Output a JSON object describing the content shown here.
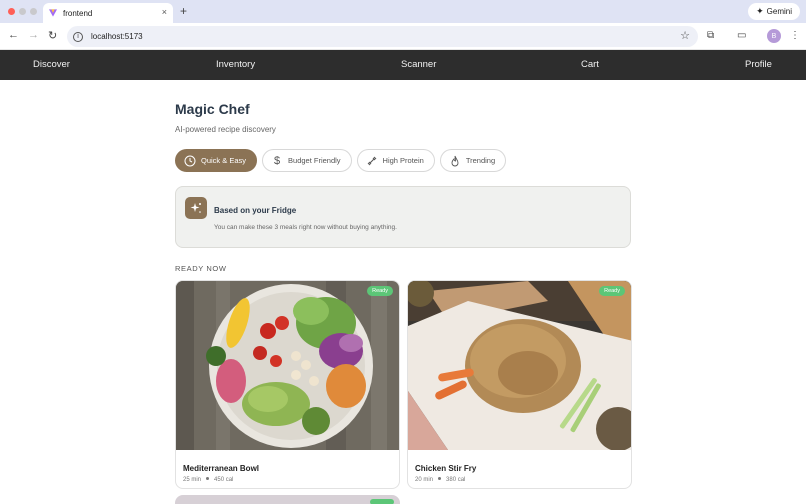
{
  "browser": {
    "tab_title": "frontend",
    "tab_close": "×",
    "new_tab": "+",
    "gemini_label": "Gemini",
    "url": "localhost:5173",
    "avatar_initial": "B"
  },
  "nav": {
    "items": [
      {
        "label": "Discover"
      },
      {
        "label": "Inventory"
      },
      {
        "label": "Scanner"
      },
      {
        "label": "Cart"
      },
      {
        "label": "Profile"
      }
    ]
  },
  "page": {
    "title": "Magic Chef",
    "subtitle": "AI-powered recipe discovery"
  },
  "filters": [
    {
      "label": "Quick & Easy",
      "icon": "clock-icon",
      "active": true
    },
    {
      "label": "Budget Friendly",
      "icon": "dollar-icon",
      "active": false
    },
    {
      "label": "High Protein",
      "icon": "dumbbell-icon",
      "active": false
    },
    {
      "label": "Trending",
      "icon": "flame-icon",
      "active": false
    }
  ],
  "fridge": {
    "heading": "Based on your Fridge",
    "description": "You can make these 3 meals right now without buying anything.",
    "icon": "sparkles-icon"
  },
  "section_label": "READY NOW",
  "recipes": [
    {
      "name": "Mediterranean Bowl",
      "time": "25 min",
      "calories": "450 cal",
      "badge": "Ready"
    },
    {
      "name": "Chicken Stir Fry",
      "time": "20 min",
      "calories": "380 cal",
      "badge": "Ready"
    }
  ],
  "colors": {
    "accent": "#8b7355",
    "nav_bg": "#2d2d2d",
    "badge_green": "#5cc677",
    "title": "#2c3a4a"
  }
}
